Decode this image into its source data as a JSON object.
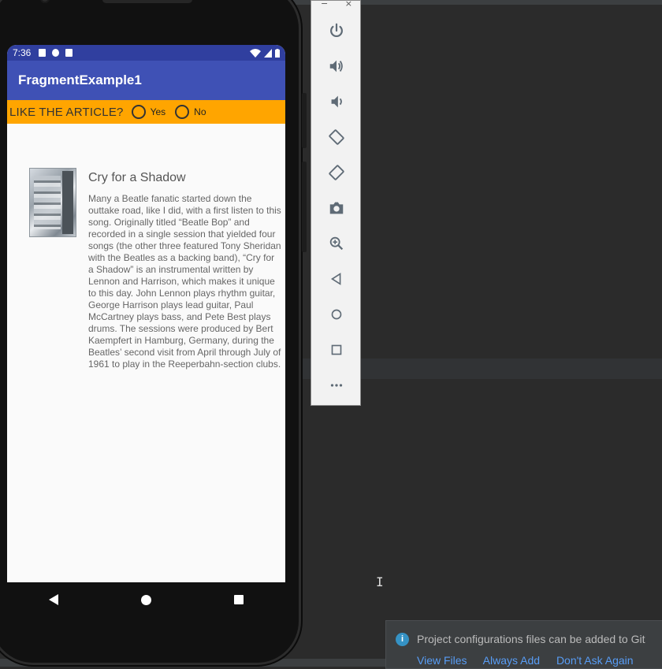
{
  "status_bar": {
    "time": "7:36"
  },
  "app": {
    "title": "FragmentExample1"
  },
  "like_bar": {
    "question": "LIKE THE ARTICLE?",
    "options": [
      "Yes",
      "No"
    ]
  },
  "article": {
    "title": "Cry for a Shadow",
    "body": "Many a Beatle fanatic started down the outtake road, like I did, with a first listen to this song. Originally titled “Beatle Bop” and recorded in a single session that yielded four songs (the other three featured Tony Sheridan with the Beatles as a backing band), “Cry for a Shadow” is an instrumental written by Lennon and Harrison, which makes it unique to this day. John Lennon plays rhythm guitar, George Harrison plays lead guitar, Paul McCartney plays bass, and Pete Best plays drums. The sessions were produced by Bert Kaempfert in Hamburg, Germany, during the Beatles’ second visit from April through July of 1961 to play in the Reeperbahn-section clubs."
  },
  "emulator_toolbar": {
    "window_controls": [
      "−",
      "×"
    ],
    "buttons": [
      "power-icon",
      "volume-up-icon",
      "volume-down-icon",
      "rotate-left-icon",
      "rotate-right-icon",
      "camera-icon",
      "zoom-icon",
      "back-icon",
      "home-icon",
      "overview-icon",
      "more-icon"
    ]
  },
  "notification": {
    "message": "Project configurations files can be added to Git",
    "links": [
      "View Files",
      "Always Add",
      "Don't Ask Again"
    ]
  },
  "colors": {
    "status_bar": "#303f9f",
    "app_bar": "#3f51b5",
    "like_bar": "#ffa500",
    "ide_background": "#2b2b2b",
    "link": "#589df6"
  }
}
